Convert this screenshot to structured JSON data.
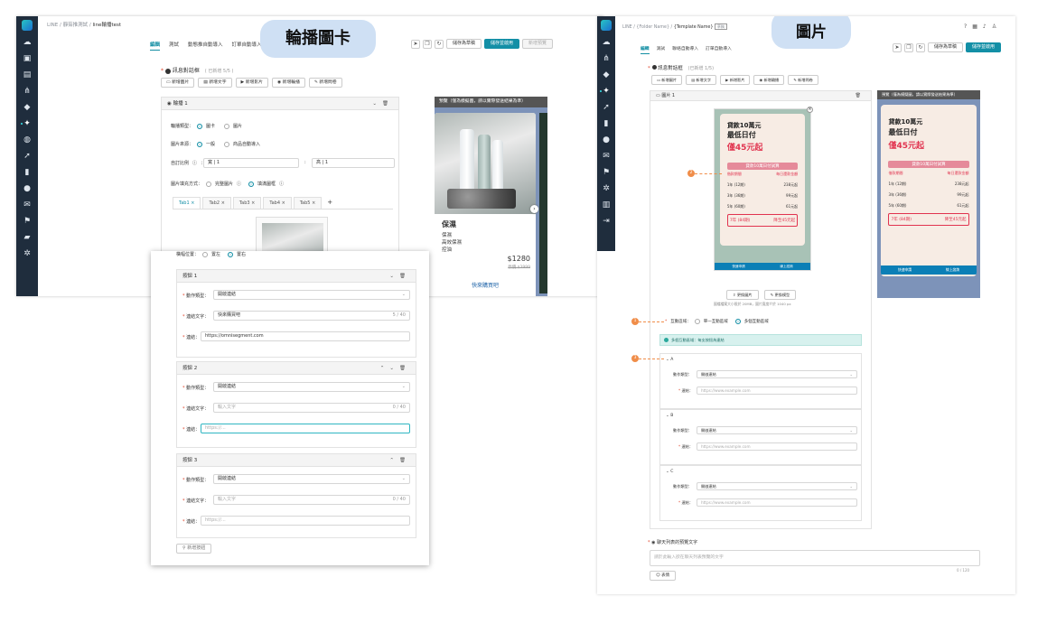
{
  "left_panel": {
    "breadcrumb": {
      "root": "LINE",
      "sep": "/",
      "folder": "靜茹推測試",
      "page": "line輪播test"
    },
    "tabs": [
      {
        "label": "編輯",
        "active": true
      },
      {
        "label": "測試",
        "active": false
      },
      {
        "label": "動態推自動導入",
        "active": false
      },
      {
        "label": "訂單自動導入",
        "active": false
      }
    ],
    "toolbar": {
      "save_draft": "儲存為草稿",
      "save_publish": "儲存並啟用",
      "new_preview": "新增預覽"
    },
    "tag_label": "輪播圖卡",
    "message_group": {
      "title": "訊息對話框",
      "count": "( 已新增 5/5 )"
    },
    "add_buttons": [
      "新增圖片",
      "新增文字",
      "新增影片",
      "新增輪播",
      "新增問卷"
    ],
    "carousel_card": {
      "title": "輪播 1"
    },
    "fields": {
      "carousel_type_label": "輪播類型：",
      "carousel_type_options": [
        "圖卡",
        "圖片"
      ],
      "image_source_label": "圖片來源：",
      "image_source_options": [
        "一般",
        "商品自動導入"
      ],
      "ratio_label": "自訂比例",
      "ratio_w_prefix": "寬",
      "ratio_w_value": "1",
      "ratio_h_prefix": "高",
      "ratio_h_value": "1",
      "ratio_sep": ":",
      "fill_label": "圖片填充方式：",
      "fill_options": [
        "完整圖片",
        "填滿圖框"
      ],
      "align_label": "橫幅位置：",
      "align_options": [
        "置左",
        "置右"
      ]
    },
    "subtabs": [
      "Tab1",
      "Tab2",
      "Tab3",
      "Tab4",
      "Tab5"
    ],
    "subtab_add": "+",
    "subtab_close": "×",
    "preview": {
      "header": "預覽（僅為模擬圖，請以實際發送結果為準）",
      "product_name": "保濕",
      "lines": [
        "保濕",
        "高效保濕",
        "控油"
      ],
      "price": "$1280",
      "original_price": "原價 $3999",
      "buy_label": "快來購買吧"
    }
  },
  "popup": {
    "buttons": [
      {
        "title": "按鈕 1",
        "action_label": "動作類型：",
        "action_value": "開啟連結",
        "text_label": "連結文字：",
        "text_value": "快來購買吧",
        "text_count": "5 / 40",
        "url_label": "連結：",
        "url_value": "https://omnisegment.com",
        "url_placeholder": ""
      },
      {
        "title": "按鈕 2",
        "action_label": "動作類型：",
        "action_value": "開啟連結",
        "text_label": "連結文字：",
        "text_value": "輸入文字",
        "text_count": "0 / 40",
        "url_label": "連結：",
        "url_value": "https://...",
        "url_placeholder": ""
      },
      {
        "title": "按鈕 3",
        "action_label": "動作類型：",
        "action_value": "開啟連結",
        "text_label": "連結文字：",
        "text_value": "輸入文字",
        "text_count": "0 / 40",
        "url_label": "連結：",
        "url_value": "https://...",
        "url_placeholder": ""
      }
    ],
    "add_button": "新增按鈕"
  },
  "right_panel": {
    "breadcrumb": {
      "root": "LINE",
      "sep": "/",
      "folder": "{Folder Name}",
      "page": "{Template Name}",
      "badge": "草稿"
    },
    "tabs": [
      {
        "label": "編輯",
        "active": true
      },
      {
        "label": "測試",
        "active": false
      },
      {
        "label": "聯絡自動導入",
        "active": false
      },
      {
        "label": "訂單自動導入",
        "active": false
      }
    ],
    "toolbar": {
      "save_draft": "儲存為草稿",
      "save_publish": "儲存並啟用"
    },
    "tag_label": "圖片",
    "message_group": {
      "title": "訊息對話框",
      "count": "(已新增 1/5)"
    },
    "add_buttons": [
      "新增圖片",
      "新增文字",
      "新增影片",
      "新增輪播",
      "新增問卷"
    ],
    "image_card": {
      "title": "圖片 1"
    },
    "poster": {
      "line1": "貸款10萬元",
      "line2": "最低日付",
      "line3": "僅45元起",
      "table_head": "貸款10萬日付試算",
      "col1": "借款期間",
      "col2": "每日還款金額",
      "rows": [
        [
          "1年 (12期)",
          "238元起"
        ],
        [
          "3年 (36期)",
          "99元起"
        ],
        [
          "5年 (60期)",
          "61元起"
        ]
      ],
      "highlight": [
        "7年 (84期)",
        "降至45元起"
      ],
      "btn_left": "快速申請",
      "btn_right": "線上諮詢"
    },
    "change_image": "更換圖片",
    "change_template": "更換模型",
    "image_hint": "圖檔檔案大小限於 20MB，圖片寬度介於 1040 px",
    "interaction_label": "互動區域：",
    "interaction_options": [
      "單一互動區域",
      "多個互動區域"
    ],
    "banner": "多個互動區域：每支按鈕為連結",
    "regions": [
      {
        "name": "A",
        "action_label": "動作類型：",
        "action_value": "開啟連結",
        "url_label": "連結：",
        "url_placeholder": "https://www.example.com"
      },
      {
        "name": "B",
        "action_label": "動作類型：",
        "action_value": "開啟連結",
        "url_label": "連結：",
        "url_placeholder": "https://www.example.com"
      },
      {
        "name": "C",
        "action_label": "動作類型：",
        "action_value": "開啟連結",
        "url_label": "連結：",
        "url_placeholder": "https://www.example.com"
      }
    ],
    "markers": [
      "2",
      "1",
      "3"
    ],
    "preview_header": "預覽（僅為模擬圖，請以實際發送結果為準）",
    "alt_text_title": "聊天列表的預覽文字",
    "alt_text_placeholder": "請於此輸入欲在聊天列表預覽的文字",
    "alt_text_count": "0 / 120",
    "emoji_button": "表情"
  },
  "colors": {
    "accent": "#138fa6",
    "sidebar": "#1f2d3d",
    "marker": "#f08d49",
    "tag": "#cfe0f4"
  }
}
